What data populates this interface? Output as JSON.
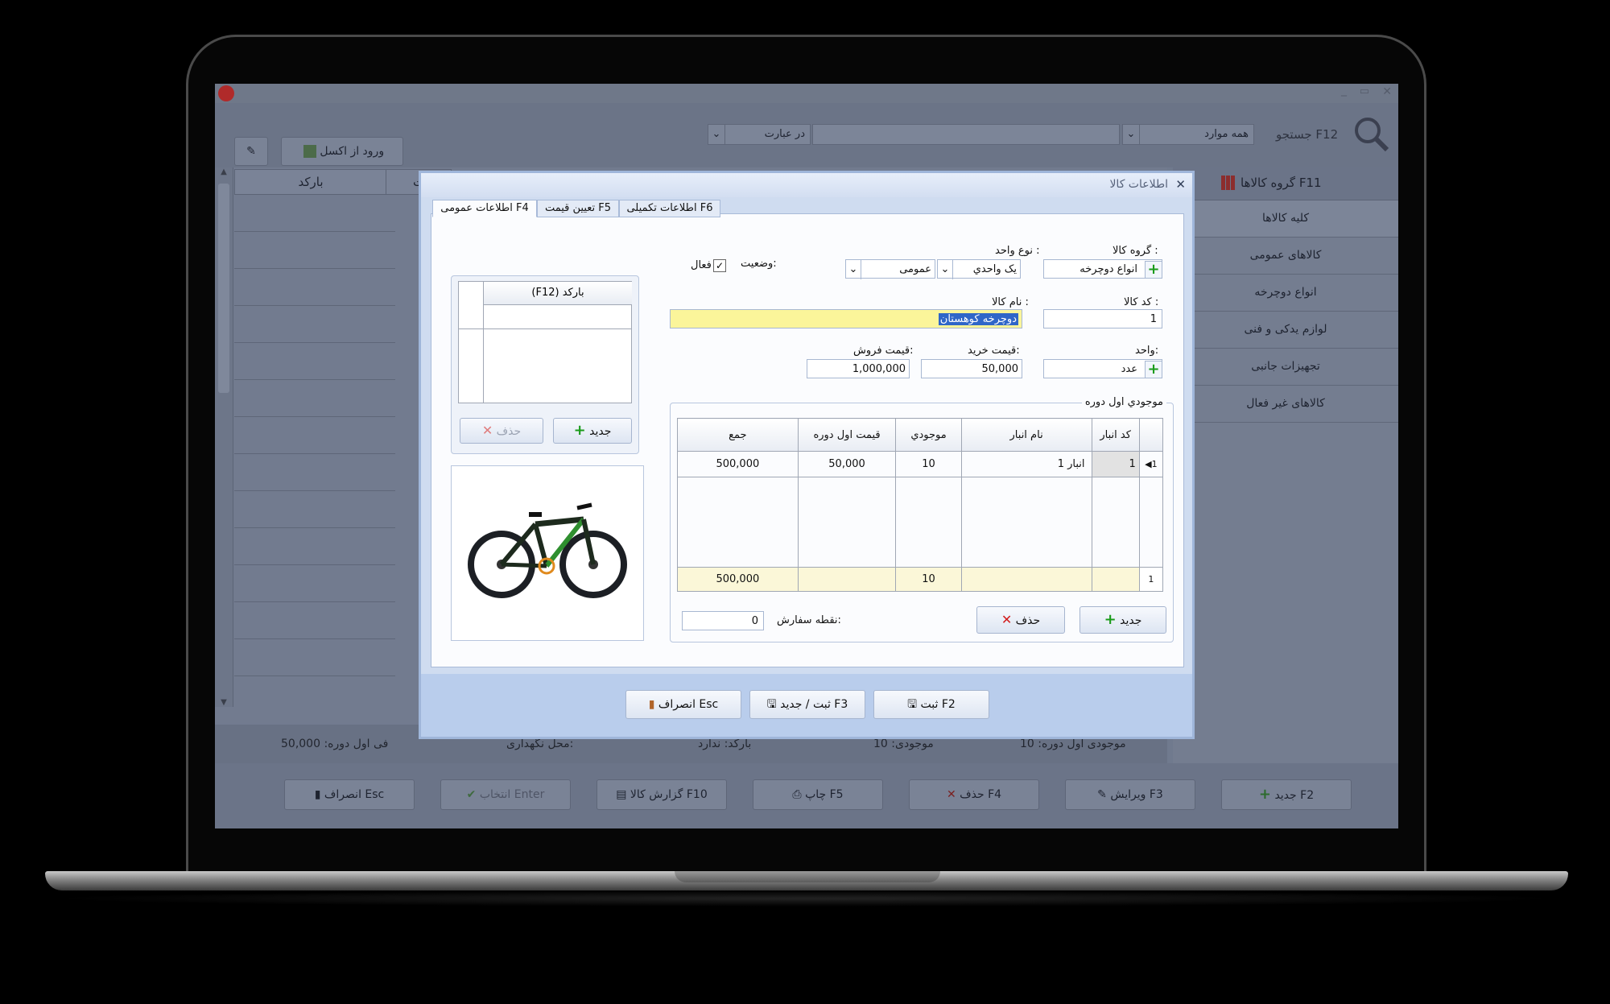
{
  "window": {
    "title": "جستجو F12"
  },
  "toolbar": {
    "search_label": "جستجو F12",
    "scope_select": "همه موارد",
    "search_value": "",
    "match_select": "در عبارت",
    "excel_import": "ورود از اکسل"
  },
  "grid": {
    "headers": [
      "بارکد",
      "ت"
    ],
    "row_count": 14
  },
  "categories": {
    "header": "گروه کالاها F11",
    "items": [
      "کلیه کالاها",
      "کالاهای عمومی",
      "انواع دوچرخه",
      "لوازم یدکی و فنی",
      "تجهیزات جانبی",
      "کالاهای غیر فعال"
    ]
  },
  "status": {
    "opening_price": "فی اول دوره: 50,000",
    "location": "محل نگهداری:",
    "barcode": "بارکد: ندارد",
    "stock": "موجودی: 10",
    "opening_stock": "موجودی اول دوره: 10"
  },
  "bottom_buttons": {
    "new": "جدید F2",
    "edit": "ویرایش F3",
    "delete": "حذف F4",
    "print": "چاپ F5",
    "report": "گزارش کالا F10",
    "select": "انتخاب Enter",
    "cancel": "انصراف Esc"
  },
  "dialog": {
    "title": "اطلاعات کالا",
    "tabs": {
      "general": "اطلاعات عمومی F4",
      "pricing": "تعیین قیمت F5",
      "extra": "اطلاعات تکمیلی F6"
    },
    "labels": {
      "group": "گروه کالا :",
      "unit_type": "نوع واحد :",
      "status": "وضعیت:",
      "active": "فعال",
      "code": "کد کالا :",
      "name": "نام کالا :",
      "unit": "واحد:",
      "buy_price": "قیمت خرید:",
      "sell_price": "قیمت فروش:",
      "opening_stock": "موجودي اول دوره",
      "reorder_point": "نقطه سفارش:"
    },
    "values": {
      "group": "انواع دوچرخه",
      "unit_type": "یک واحدي",
      "unit_scope": "عمومی",
      "code": "1",
      "name": "دوچرخه کوهستان",
      "unit": "عدد",
      "buy_price": "50,000",
      "sell_price": "1,000,000",
      "reorder_point": "0",
      "active": true
    },
    "stock_table": {
      "headers": [
        "کد انبار",
        "نام انبار",
        "موجودي",
        "قیمت اول دوره",
        "جمع"
      ],
      "rows": [
        {
          "indicator": "1",
          "code": "1",
          "warehouse": "انبار 1",
          "qty": "10",
          "price": "50,000",
          "total": "500,000"
        }
      ],
      "footer": {
        "indicator": "1",
        "qty": "10",
        "total": "500,000"
      }
    },
    "barcode_panel": {
      "header": "(F12) بارکد",
      "new": "جدید",
      "delete": "حذف"
    },
    "stock_buttons": {
      "new": "جدید",
      "delete": "حذف"
    },
    "footer_buttons": {
      "save": "ثبت F2",
      "save_new": "ثبت / جدید F3",
      "cancel": "انصراف Esc"
    }
  }
}
